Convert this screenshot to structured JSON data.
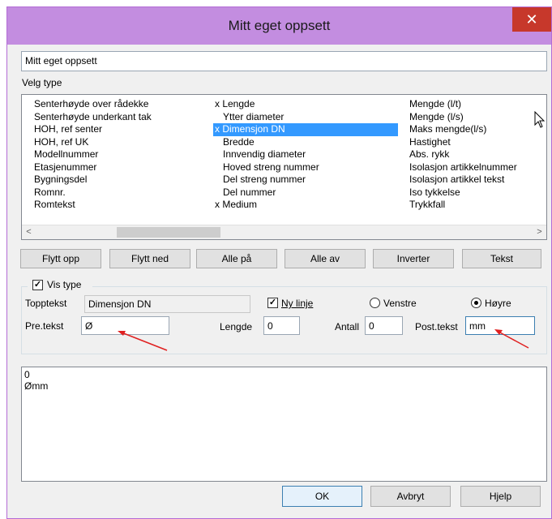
{
  "window": {
    "title": "Mitt eget oppsett",
    "close_glyph": "✕"
  },
  "name_field": {
    "value": "Mitt eget oppsett"
  },
  "type_section": {
    "label": "Velg type"
  },
  "type_list": {
    "col1": [
      "Senterhøyde over rådekke",
      "Senterhøyde underkant tak",
      "HOH, ref senter",
      "HOH, ref UK",
      "Modellnummer",
      "Etasjenummer",
      "Bygningsdel",
      "Romnr.",
      "Romtekst"
    ],
    "col2": [
      "x Lengde",
      "Ytter diameter",
      "x Dimensjon DN",
      "Bredde",
      "Innvendig diameter",
      "Hoved streng nummer",
      "Del streng nummer",
      "Del nummer",
      "x Medium"
    ],
    "col3": [
      "Mengde (l/t)",
      "Mengde (l/s)",
      "Maks mengde(l/s)",
      "Hastighet",
      "Abs. rykk",
      "Isolasjon artikkelnummer",
      "Isolasjon artikkel tekst",
      "Iso tykkelse",
      "Trykkfall"
    ],
    "selected": "x Dimensjon DN",
    "scroll_left": "<",
    "scroll_right": ">"
  },
  "toolbar": {
    "move_up": "Flytt opp",
    "move_down": "Flytt ned",
    "all_on": "Alle på",
    "all_off": "Alle av",
    "invert": "Inverter",
    "text": "Tekst"
  },
  "settings": {
    "show_type_label": "Vis type",
    "show_type_checked": true,
    "top_text_label": "Topptekst",
    "top_text_value": "Dimensjon DN",
    "new_line_label": "Ny linje",
    "new_line_checked": true,
    "left_label": "Venstre",
    "right_label": "Høyre",
    "alignment": "Høyre",
    "pre_text_label": "Pre.tekst",
    "pre_text_value": "Ø",
    "length_label": "Lengde",
    "length_value": "0",
    "count_label": "Antall",
    "count_value": "0",
    "post_text_label": "Post.tekst",
    "post_text_value": "mm"
  },
  "preview": {
    "lines": [
      "0",
      "Ømm"
    ]
  },
  "footer": {
    "ok": "OK",
    "cancel": "Avbryt",
    "help": "Hjelp"
  },
  "annotations": {
    "arrow_color": "#e02020"
  }
}
